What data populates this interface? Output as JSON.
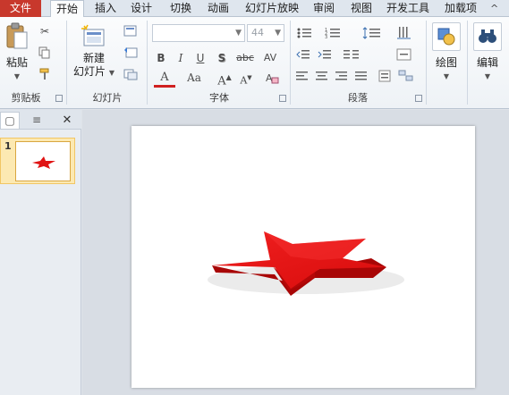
{
  "tabs": {
    "file": "文件",
    "items": [
      "开始",
      "插入",
      "设计",
      "切换",
      "动画",
      "幻灯片放映",
      "审阅",
      "视图",
      "开发工具",
      "加载项"
    ],
    "active_index": 0,
    "minimize_glyph": "^"
  },
  "ribbon": {
    "clipboard": {
      "paste_label": "粘贴",
      "group_label": "剪贴板",
      "icons": [
        "cut-icon",
        "copy-icon",
        "format-painter-icon"
      ]
    },
    "slides": {
      "new_slide_label_line1": "新建",
      "new_slide_label_line2": "幻灯片",
      "group_label": "幻灯片",
      "icons": [
        "layout-icon",
        "reset-icon",
        "section-icon"
      ]
    },
    "font": {
      "font_name": "",
      "font_size": "44",
      "group_label": "字体",
      "format_buttons": [
        "B",
        "I",
        "U",
        "S",
        "abc",
        "AV"
      ],
      "row3_buttons": [
        "A",
        "Aa",
        "A+",
        "A-",
        "clear-format"
      ]
    },
    "paragraph": {
      "group_label": "段落"
    },
    "drawing": {
      "label": "绘图"
    },
    "editing": {
      "label": "编辑"
    }
  },
  "pane": {
    "tab_slides": "▢",
    "tab_outline": "≡",
    "close": "✕",
    "slide_number": "1"
  },
  "colors": {
    "file_tab": "#c8382c",
    "star": "#e01414",
    "thumb_highlight": "#fce9b2"
  }
}
